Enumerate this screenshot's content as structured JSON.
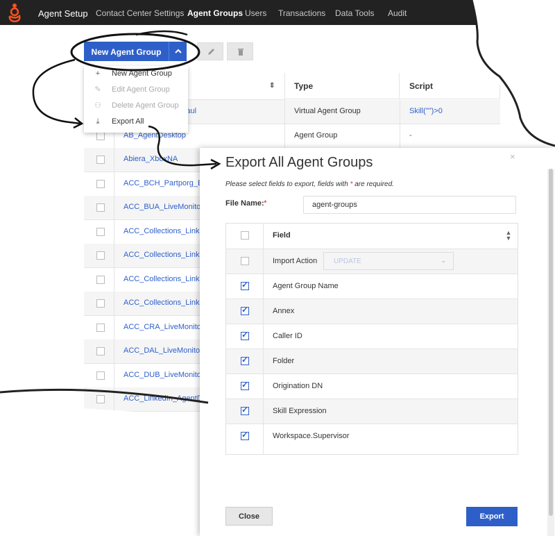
{
  "nav": {
    "brand": "Agent Setup",
    "items": [
      "Contact Center Settings",
      "Agent Groups",
      "Users",
      "Transactions",
      "Data Tools",
      "Audit"
    ],
    "active": "Agent Groups"
  },
  "toolbar": {
    "new_group_label": "New Agent Group"
  },
  "dropdown": {
    "items": [
      {
        "label": "New Agent Group",
        "icon": "plus-icon",
        "disabled": false
      },
      {
        "label": "Edit Agent Group",
        "icon": "pencil-icon",
        "disabled": true
      },
      {
        "label": "Delete Agent Group",
        "icon": "delete-user-icon",
        "disabled": true
      },
      {
        "label": "Export All",
        "icon": "download-icon",
        "disabled": false
      }
    ]
  },
  "table": {
    "columns": {
      "type": "Type",
      "script": "Script"
    },
    "rows": [
      {
        "name": "Paul",
        "type": "Virtual Agent Group",
        "script": "Skill(\"\")>0"
      },
      {
        "name": "AB_AgentDesktop",
        "type": "Agent Group",
        "script": "-"
      },
      {
        "name": "Abiera_XboxNA",
        "type": "",
        "script": ""
      },
      {
        "name": "ACC_BCH_Partporg_EM",
        "type": "",
        "script": ""
      },
      {
        "name": "ACC_BUA_LiveMonitori",
        "type": "",
        "script": ""
      },
      {
        "name": "ACC_Collections_Linke",
        "type": "",
        "script": ""
      },
      {
        "name": "ACC_Collections_Linke",
        "type": "",
        "script": ""
      },
      {
        "name": "ACC_Collections_Linke",
        "type": "",
        "script": ""
      },
      {
        "name": "ACC_Collections_Linke",
        "type": "",
        "script": ""
      },
      {
        "name": "ACC_CRA_LiveMonitori",
        "type": "",
        "script": ""
      },
      {
        "name": "ACC_DAL_LiveMonitori",
        "type": "",
        "script": ""
      },
      {
        "name": "ACC_DUB_LiveMonitori",
        "type": "",
        "script": ""
      },
      {
        "name": "ACC_LinkedIn_AgentDe",
        "type": "",
        "script": ""
      }
    ]
  },
  "modal": {
    "title": "Export All Agent Groups",
    "note_prefix": "Please select fields to export, fields with",
    "note_star": "*",
    "note_suffix": "are required.",
    "file_name_label": "File Name:",
    "required_star": "*",
    "file_name_value": "agent-groups",
    "field_header": "Field",
    "import_action_label": "Import Action",
    "import_action_value": "UPDATE",
    "fields": [
      {
        "label": "Agent Group Name",
        "checked": true
      },
      {
        "label": "Annex",
        "checked": true
      },
      {
        "label": "Caller ID",
        "checked": true
      },
      {
        "label": "Folder",
        "checked": true
      },
      {
        "label": "Origination DN",
        "checked": true
      },
      {
        "label": "Skill Expression",
        "checked": true
      },
      {
        "label": "Workspace.Supervisor",
        "checked": true
      }
    ],
    "close_label": "Close",
    "export_label": "Export",
    "close_icon": "×"
  },
  "colors": {
    "accent": "#2e5fc9",
    "nav_bg": "#222222",
    "logo": "#ff4f1f"
  }
}
